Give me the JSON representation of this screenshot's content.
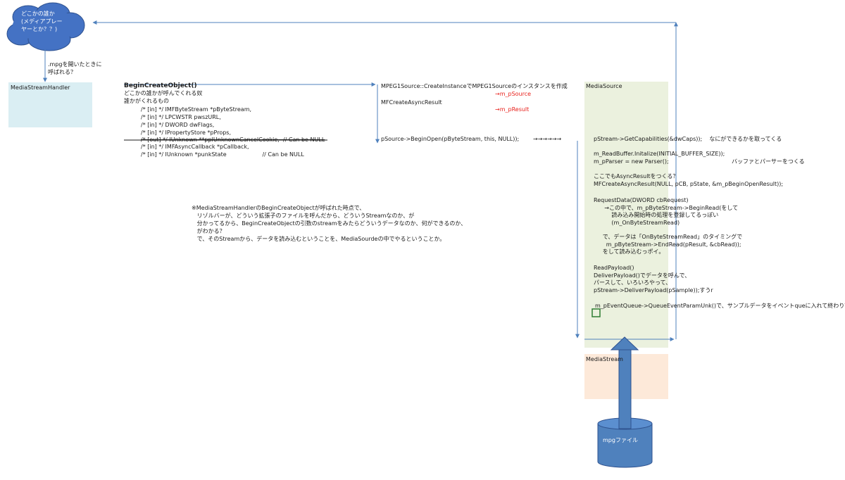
{
  "cloud": {
    "text": "どこかの誰か\n(メディアプレー\nヤーとか？？)"
  },
  "mpg_note": ".mpgを開いたときに\n呼ばれる？",
  "media_stream_handler": {
    "label": "MediaStreamHandler"
  },
  "begin_create": {
    "title": "BeginCreateObject()",
    "desc": "どこかの誰かが呼んでくれる奴\n誰かがくれるもの",
    "params": [
      "/* [in] */ IMFByteStream *pByteStream,",
      "/* [in] */ LPCWSTR pwszURL,",
      "/* [in] */ DWORD dwFlags,",
      "/* [in] */ IPropertyStore *pProps,"
    ],
    "param_struck": "/* [out] */ IUnknown **ppIUnknownCancelCookie,  // Can be NULL",
    "params_after": [
      "/* [in] */ IMFAsyncCallback *pCallback,",
      "/* [in] */ IUnknown *punkState                    // Can be NULL"
    ]
  },
  "mpeg1": {
    "create": "MPEG1Source::CreateInstanceでMPEG1Sourceのインスタンスを作成",
    "m_psource": "→m_pSource",
    "async": "MFCreateAsyncResult",
    "m_presult": "→m_pResult",
    "begin_open": "pSource->BeginOpen(pByteStream, this, NULL));",
    "arrows": "→→→→→→"
  },
  "note": "※MediaStreamHandlerのBeginCreateObjectが呼ばれた時点で、\n   リゾルバーが、どういう拡張子のファイルを呼んだから、どういうStreamなのか、が\n   分かってるから、BeginCreateObjectの引数のstreamをみたらどういうデータなのか、何ができるのか、\n   がわかる？\n   で、そのStreamから、データを読み込むということを、MediaSourdeの中でやるということか。",
  "media_source": {
    "label": "MediaSource",
    "caps": "pStream->GetCapabilities(&dwCaps));    なにができるかを取ってくる",
    "readbuf": "m_ReadBuffer.Initalize(INITIAL_BUFFER_SIZE));",
    "parser": "m_pParser = new Parser();",
    "parser_note": "バッファとパーサーをつくる",
    "async_q": "ここでもAsyncResultをつくる？",
    "async_call": "MFCreateAsyncResult(NULL, pCB, pState, &m_pBeginOpenResult));",
    "request_data": "RequestData(DWORD cbRequest)\n      →この中で、m_pByteStream->BeginRead(をして\n          読み込み開始時の処理を登録してるっぽい\n          (m_OnByteStreamRead)",
    "read_timing": "     で、データは「OnByteStreamRead」のタイミングで\n       m_pByteStream->EndRead(pResult, &cbRead));\n     をして読み込むっポイ。",
    "read_payload": "ReadPayload()\nDeliverPayload()でデータを呼んで、\nパースして、いろいろやって、\npStream->DeliverPayload(pSample));すうr",
    "queue": "m_pEventQueue->QueueEventParamUnk()で、サンプルデータをイベントqueに入れて終わり？"
  },
  "media_stream": {
    "label": "MediaStream"
  },
  "mpg_file": {
    "label": "mpgファイル"
  },
  "colors": {
    "cloud": "#4472c4",
    "handler_box": "#daeef3",
    "source_box": "#ebf1de",
    "stream_box": "#fde9d9",
    "connector": "#4f81bd",
    "red": "#e8201b",
    "cylinder": "#4f81bd"
  }
}
